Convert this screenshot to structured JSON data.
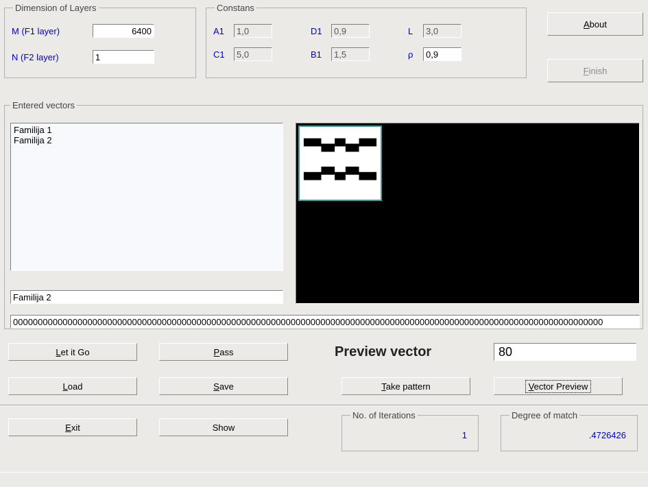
{
  "dimension": {
    "legend": "Dimension of Layers",
    "m_label": "M (F1 layer)",
    "m_value": "6400",
    "n_label": "N (F2 layer)",
    "n_value": "1"
  },
  "constants": {
    "legend": "Constans",
    "a1_label": "A1",
    "a1_value": "1,0",
    "c1_label": "C1",
    "c1_value": "5,0",
    "d1_label": "D1",
    "d1_value": "0,9",
    "b1_label": "B1",
    "b1_value": "1,5",
    "l_label": "L",
    "l_value": "3,0",
    "rho_label": "ρ",
    "rho_value": "0,9"
  },
  "top_buttons": {
    "about_pre": "",
    "about_u": "A",
    "about_post": "bout",
    "finish_pre": "",
    "finish_u": "F",
    "finish_post": "inish"
  },
  "entered": {
    "legend": "Entered vectors",
    "item1": "Familija 1",
    "item2": "Familija 2",
    "selected_text": "Familija 2"
  },
  "longstr": "00000000000000000000000000000000000000000000000000000000000000000000000000000000000000000000000000000000000000000000000",
  "buttons": {
    "letitgo_pre": "",
    "letitgo_u": "L",
    "letitgo_post": "et it Go",
    "pass_pre": "",
    "pass_u": "P",
    "pass_post": "ass",
    "load_pre": "",
    "load_u": "L",
    "load_post": "oad",
    "save_pre": "",
    "save_u": "S",
    "save_post": "ave",
    "exit_pre": "",
    "exit_u": "E",
    "exit_post": "xit",
    "show": "Show",
    "take_pre": "",
    "take_u": "T",
    "take_post": "ake pattern",
    "vecprev_pre": "",
    "vecprev_u": "V",
    "vecprev_post": "ector Preview"
  },
  "preview": {
    "label": "Preview vector",
    "value": "80"
  },
  "iterations": {
    "legend": "No. of Iterations",
    "value": "1"
  },
  "match": {
    "legend": "Degree of match",
    "value": ".4726426"
  }
}
